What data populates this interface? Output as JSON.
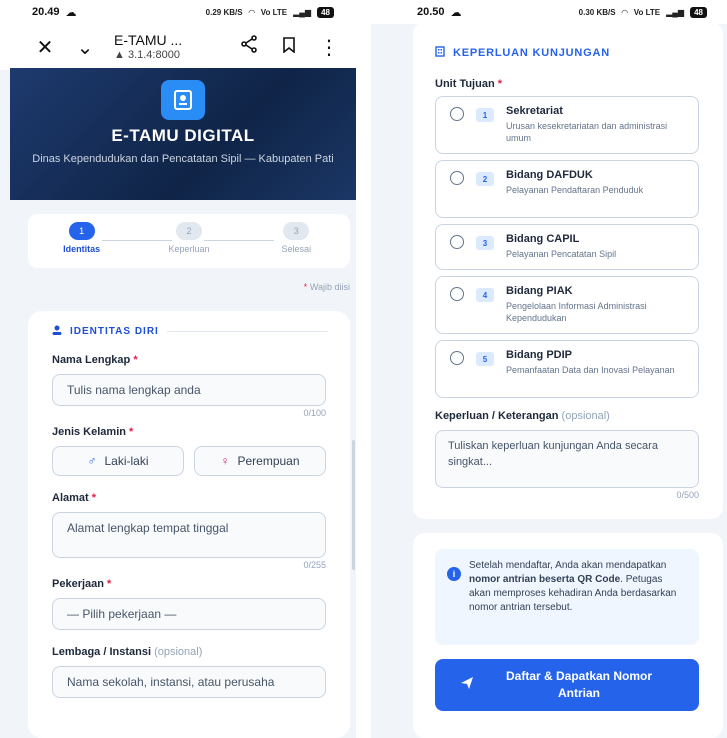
{
  "left": {
    "status": {
      "time": "20.49",
      "net": "0.29 KB/S",
      "volte": "Vo LTE",
      "battery": "48"
    },
    "browser": {
      "title": "E-TAMU ...",
      "url": "3.1.4:8000"
    },
    "hero": {
      "title": "E-TAMU DIGITAL",
      "subtitle": "Dinas Kependudukan dan Pencatatan Sipil — Kabupaten Pati"
    },
    "steps": [
      {
        "num": "1",
        "label": "Identitas"
      },
      {
        "num": "2",
        "label": "Keperluan"
      },
      {
        "num": "3",
        "label": "Selesai"
      }
    ],
    "required_note": "Wajib diisi",
    "section_title": "IDENTITAS DIRI",
    "fields": {
      "nama_label": "Nama Lengkap",
      "nama_placeholder": "Tulis nama lengkap anda",
      "nama_counter": "0/100",
      "gender_label": "Jenis Kelamin",
      "male": "Laki-laki",
      "female": "Perempuan",
      "alamat_label": "Alamat",
      "alamat_placeholder": "Alamat lengkap tempat tinggal",
      "alamat_counter": "0/255",
      "pekerjaan_label": "Pekerjaan",
      "pekerjaan_value": "— Pilih pekerjaan —",
      "lembaga_label": "Lembaga / Instansi",
      "lembaga_optional": "(opsional)",
      "lembaga_placeholder": "Nama sekolah, instansi, atau perusaha"
    }
  },
  "right": {
    "status": {
      "time": "20.50",
      "net": "0.30 KB/S",
      "volte": "Vo LTE",
      "battery": "48"
    },
    "section_title": "KEPERLUAN KUNJUNGAN",
    "unit_label": "Unit Tujuan",
    "units": [
      {
        "num": "1",
        "name": "Sekretariat",
        "desc": "Urusan kesekretariatan dan administrasi umum"
      },
      {
        "num": "2",
        "name": "Bidang DAFDUK",
        "desc": "Pelayanan Pendaftaran Penduduk"
      },
      {
        "num": "3",
        "name": "Bidang CAPIL",
        "desc": "Pelayanan Pencatatan Sipil"
      },
      {
        "num": "4",
        "name": "Bidang PIAK",
        "desc": "Pengelolaan Informasi Administrasi Kependudukan"
      },
      {
        "num": "5",
        "name": "Bidang PDIP",
        "desc": "Pemanfaatan Data dan Inovasi Pelayanan"
      }
    ],
    "keperluan_label": "Keperluan / Keterangan",
    "keperluan_optional": "(opsional)",
    "keperluan_placeholder": "Tuliskan keperluan kunjungan Anda secara singkat...",
    "keperluan_counter": "0/500",
    "info": {
      "part1": "Setelah mendaftar, Anda akan mendapatkan ",
      "bold": "nomor antrian beserta QR Code",
      "part2": ". Petugas akan memproses kehadiran Anda berdasarkan nomor antrian tersebut."
    },
    "submit_label": "Daftar & Dapatkan Nomor Antrian"
  }
}
